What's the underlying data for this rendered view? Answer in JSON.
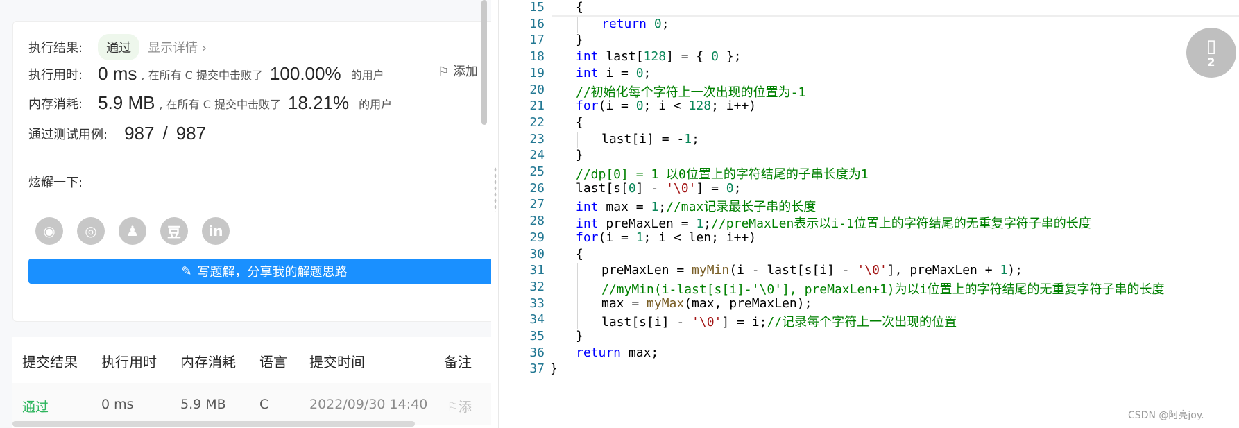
{
  "result": {
    "status_label": "执行结果:",
    "status": "通过",
    "detail_link": "显示详情 ›",
    "add_note": "添加",
    "runtime": {
      "label": "执行用时:",
      "value": "0 ms",
      "mid": ", 在所有 C 提交中击败了",
      "percent": "100.00%",
      "suffix": "的用户"
    },
    "memory": {
      "label": "内存消耗:",
      "value": "5.9 MB",
      "mid": ", 在所有 C 提交中击败了",
      "percent": "18.21%",
      "suffix": "的用户"
    },
    "tests": {
      "label": "通过测试用例:",
      "passed": "987",
      "sep": "/",
      "total": "987"
    },
    "share_label": "炫耀一下:",
    "share_icons": [
      {
        "name": "wechat-icon",
        "glyph": "◉"
      },
      {
        "name": "weibo-icon",
        "glyph": "◎"
      },
      {
        "name": "qq-icon",
        "glyph": "♟"
      },
      {
        "name": "douban-icon",
        "glyph": "豆"
      },
      {
        "name": "linkedin-icon",
        "glyph": "in"
      }
    ],
    "write_button": "写题解，分享我的解题思路"
  },
  "submissions": {
    "headers": [
      "提交结果",
      "执行用时",
      "内存消耗",
      "语言",
      "提交时间",
      "备注"
    ],
    "rows": [
      {
        "result": "通过",
        "time": "0 ms",
        "memory": "5.9 MB",
        "language": "C",
        "submitted": "2022/09/30 14:40",
        "note": "添"
      }
    ]
  },
  "code": {
    "lines": [
      {
        "n": "15",
        "indent": 1,
        "tokens": [
          [
            "txt",
            "{"
          ]
        ]
      },
      {
        "n": "16",
        "indent": 2,
        "tokens": [
          [
            "kw",
            "return"
          ],
          [
            "txt",
            " "
          ],
          [
            "num",
            "0"
          ],
          [
            "txt",
            ";"
          ]
        ]
      },
      {
        "n": "17",
        "indent": 1,
        "tokens": [
          [
            "txt",
            "}"
          ]
        ]
      },
      {
        "n": "18",
        "indent": 1,
        "tokens": [
          [
            "ty",
            "int"
          ],
          [
            "txt",
            " last["
          ],
          [
            "num",
            "128"
          ],
          [
            "txt",
            "] = { "
          ],
          [
            "num",
            "0"
          ],
          [
            "txt",
            " };"
          ]
        ]
      },
      {
        "n": "19",
        "indent": 1,
        "tokens": [
          [
            "ty",
            "int"
          ],
          [
            "txt",
            " i = "
          ],
          [
            "num",
            "0"
          ],
          [
            "txt",
            ";"
          ]
        ]
      },
      {
        "n": "20",
        "indent": 1,
        "tokens": [
          [
            "cm",
            "//初始化每个字符上一次出现的位置为-1"
          ]
        ]
      },
      {
        "n": "21",
        "indent": 1,
        "tokens": [
          [
            "kw",
            "for"
          ],
          [
            "txt",
            "(i = "
          ],
          [
            "num",
            "0"
          ],
          [
            "txt",
            "; i < "
          ],
          [
            "num",
            "128"
          ],
          [
            "txt",
            "; i++)"
          ]
        ]
      },
      {
        "n": "22",
        "indent": 1,
        "tokens": [
          [
            "txt",
            "{"
          ]
        ]
      },
      {
        "n": "23",
        "indent": 2,
        "tokens": [
          [
            "txt",
            "last[i] = -"
          ],
          [
            "num",
            "1"
          ],
          [
            "txt",
            ";"
          ]
        ]
      },
      {
        "n": "24",
        "indent": 1,
        "tokens": [
          [
            "txt",
            "}"
          ]
        ]
      },
      {
        "n": "25",
        "indent": 1,
        "tokens": [
          [
            "cm",
            "//dp[0] = 1 以0位置上的字符结尾的子串长度为1"
          ]
        ]
      },
      {
        "n": "26",
        "indent": 1,
        "tokens": [
          [
            "txt",
            "last[s["
          ],
          [
            "num",
            "0"
          ],
          [
            "txt",
            "] - "
          ],
          [
            "str",
            "'\\0'"
          ],
          [
            "txt",
            "] = "
          ],
          [
            "num",
            "0"
          ],
          [
            "txt",
            ";"
          ]
        ]
      },
      {
        "n": "27",
        "indent": 1,
        "tokens": [
          [
            "ty",
            "int"
          ],
          [
            "txt",
            " max = "
          ],
          [
            "num",
            "1"
          ],
          [
            "txt",
            ";"
          ],
          [
            "cm",
            "//max记录最长子串的长度"
          ]
        ]
      },
      {
        "n": "28",
        "indent": 1,
        "tokens": [
          [
            "ty",
            "int"
          ],
          [
            "txt",
            " preMaxLen = "
          ],
          [
            "num",
            "1"
          ],
          [
            "txt",
            ";"
          ],
          [
            "cm",
            "//preMaxLen表示以i-1位置上的字符结尾的无重复字符子串的长度"
          ]
        ]
      },
      {
        "n": "29",
        "indent": 1,
        "tokens": [
          [
            "kw",
            "for"
          ],
          [
            "txt",
            "(i = "
          ],
          [
            "num",
            "1"
          ],
          [
            "txt",
            "; i < len; i++)"
          ]
        ]
      },
      {
        "n": "30",
        "indent": 1,
        "tokens": [
          [
            "txt",
            "{"
          ]
        ]
      },
      {
        "n": "31",
        "indent": 2,
        "tokens": [
          [
            "txt",
            "preMaxLen = "
          ],
          [
            "fn",
            "myMin"
          ],
          [
            "txt",
            "(i - last[s[i] - "
          ],
          [
            "str",
            "'\\0'"
          ],
          [
            "txt",
            "], preMaxLen + "
          ],
          [
            "num",
            "1"
          ],
          [
            "txt",
            ");"
          ]
        ]
      },
      {
        "n": "32",
        "indent": 2,
        "tokens": [
          [
            "cm",
            "//myMin(i-last[s[i]-'\\0'], preMaxLen+1)为以i位置上的字符结尾的无重复字符子串的长度"
          ]
        ]
      },
      {
        "n": "33",
        "indent": 2,
        "tokens": [
          [
            "txt",
            "max = "
          ],
          [
            "fn",
            "myMax"
          ],
          [
            "txt",
            "(max, preMaxLen);"
          ]
        ]
      },
      {
        "n": "34",
        "indent": 2,
        "tokens": [
          [
            "txt",
            "last[s[i] - "
          ],
          [
            "str",
            "'\\0'"
          ],
          [
            "txt",
            "] = i;"
          ],
          [
            "cm",
            "//记录每个字符上一次出现的位置"
          ]
        ]
      },
      {
        "n": "35",
        "indent": 1,
        "tokens": [
          [
            "txt",
            "}"
          ]
        ]
      },
      {
        "n": "36",
        "indent": 1,
        "tokens": [
          [
            "kw",
            "return"
          ],
          [
            "txt",
            " max;"
          ]
        ]
      },
      {
        "n": "37",
        "indent": 0,
        "tokens": [
          [
            "txt",
            "}"
          ]
        ]
      }
    ]
  },
  "floating_badge": {
    "icon": "bookmark-icon",
    "count": "2"
  },
  "watermark": "CSDN @阿亮joy."
}
